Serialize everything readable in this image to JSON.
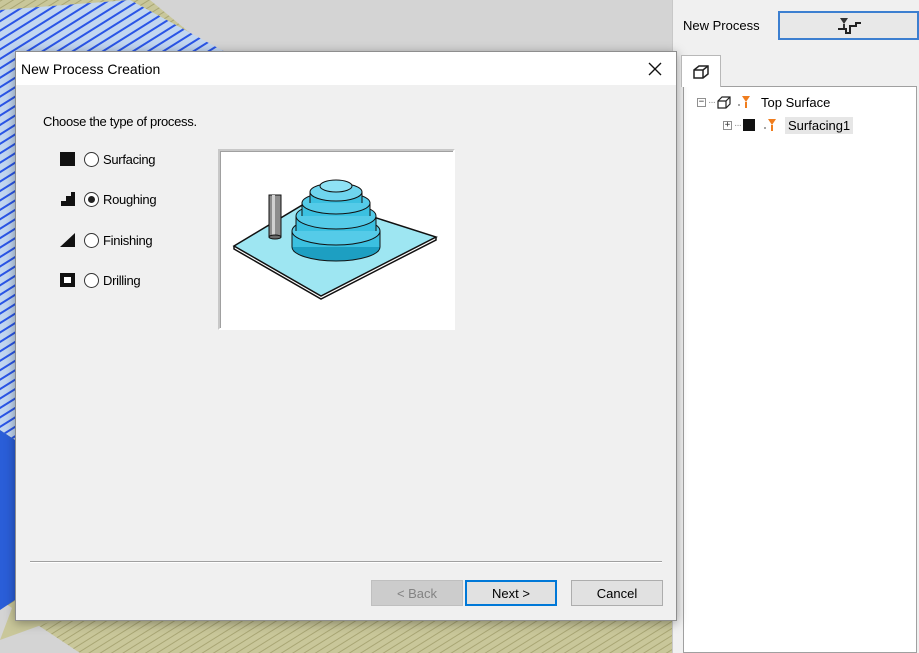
{
  "side_panel": {
    "label": "New Process",
    "tree": {
      "root": {
        "expander": "−",
        "label": "Top Surface"
      },
      "child": {
        "expander": "+",
        "label": "Surfacing1"
      }
    }
  },
  "dialog": {
    "title": "New Process Creation",
    "prompt": "Choose the type of process.",
    "options": [
      {
        "label": "Surfacing",
        "icon": "surfacing-icon",
        "selected": false
      },
      {
        "label": "Roughing",
        "icon": "roughing-icon",
        "selected": true
      },
      {
        "label": "Finishing",
        "icon": "finishing-icon",
        "selected": false
      },
      {
        "label": "Drilling",
        "icon": "drilling-icon",
        "selected": false
      }
    ],
    "buttons": {
      "back": "< Back",
      "next": "Next >",
      "cancel": "Cancel"
    }
  },
  "colors": {
    "focus_border": "#0078d7",
    "model_fill": "#3bc0e0",
    "plate_fill": "#9ee6f2",
    "toolpath": "#2a55e6"
  }
}
